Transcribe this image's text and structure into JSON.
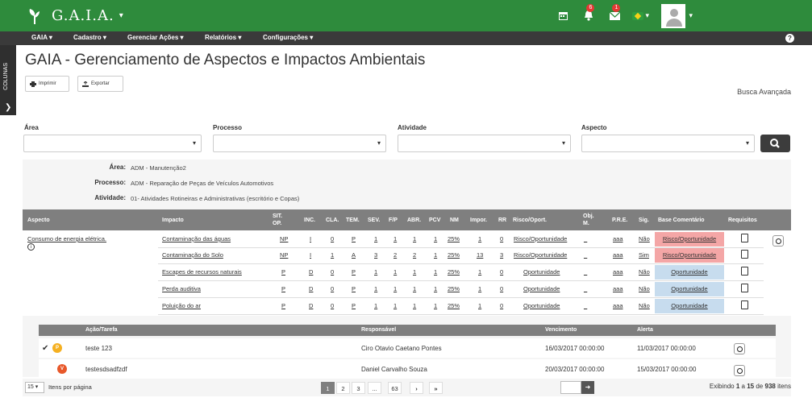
{
  "app": {
    "brand": "G.A.I.A.",
    "brand_caret": "▾"
  },
  "top_icons": {
    "notifications_count": "6",
    "messages_count": "1"
  },
  "menu": [
    {
      "label": "GAIA ▾"
    },
    {
      "label": "Cadastro ▾"
    },
    {
      "label": "Gerenciar Ações ▾"
    },
    {
      "label": "Relatórios ▾"
    },
    {
      "label": "Configurações ▾"
    }
  ],
  "help_label": "?",
  "side_panel": {
    "label": "COLUNAS"
  },
  "page_title": "GAIA - Gerenciamento de Aspectos e Impactos Ambientais",
  "toolbar": {
    "print_label": "Imprimir",
    "export_label": "Exportar"
  },
  "advanced_search": "Busca Avançada",
  "filters": [
    {
      "label": "Área",
      "value": ""
    },
    {
      "label": "Processo",
      "value": ""
    },
    {
      "label": "Atividade",
      "value": ""
    },
    {
      "label": "Aspecto",
      "value": ""
    }
  ],
  "info": {
    "area_label": "Área:",
    "area_value": "ADM - Manutenção2",
    "processo_label": "Processo:",
    "processo_value": "ADM - Reparação de Peças de Veículos Automotivos",
    "atividade_label": "Atividade:",
    "atividade_value": "01- Atividades Rotineiras e Administrativas (escritório e Copas)"
  },
  "table": {
    "headers": [
      "Aspecto",
      "Impacto",
      "SIT. OP.",
      "INC.",
      "CLA.",
      "TEM.",
      "SEV.",
      "F/P",
      "ABR.",
      "PCV",
      "NM",
      "Impor.",
      "RR",
      "Risco/Oport.",
      "Obj. M.",
      "P.R.E.",
      "Sig.",
      "Base Comentário",
      "Requisitos"
    ],
    "aspecto": "Consumo de energia elétrica.",
    "rows": [
      {
        "impacto": "Contaminação das águas",
        "sit": "NP",
        "inc": "I",
        "cla": "0",
        "tem": "P",
        "sev": "1",
        "fp": "1",
        "abr": "1",
        "pcv": "1",
        "nm": "25%",
        "impor": "1",
        "rr": "0",
        "risco": "Risco/Oportunidade",
        "obj": "_",
        "pre": "aaa",
        "sig": "Não",
        "base": "Risco/Oportunidade",
        "base_color": "#f4a6a6"
      },
      {
        "impacto": "Contaminação do Solo",
        "sit": "NP",
        "inc": "I",
        "cla": "1",
        "tem": "A",
        "sev": "3",
        "fp": "2",
        "abr": "2",
        "pcv": "1",
        "nm": "25%",
        "impor": "13",
        "rr": "3",
        "risco": "Risco/Oportunidade",
        "obj": "_",
        "pre": "aaa",
        "sig": "Sim",
        "base": "Risco/Oportunidade",
        "base_color": "#f4a6a6"
      },
      {
        "impacto": "Escapes de recursos naturais",
        "sit": "P",
        "inc": "D",
        "cla": "0",
        "tem": "P",
        "sev": "1",
        "fp": "1",
        "abr": "1",
        "pcv": "1",
        "nm": "25%",
        "impor": "1",
        "rr": "0",
        "risco": "Oportunidade",
        "obj": "_",
        "pre": "aaa",
        "sig": "Não",
        "base": "Oportunidade",
        "base_color": "#c7dcee"
      },
      {
        "impacto": "Perda auditiva",
        "sit": "P",
        "inc": "D",
        "cla": "0",
        "tem": "P",
        "sev": "1",
        "fp": "1",
        "abr": "1",
        "pcv": "1",
        "nm": "25%",
        "impor": "1",
        "rr": "0",
        "risco": "Oportunidade",
        "obj": "_",
        "pre": "aaa",
        "sig": "Não",
        "base": "Oportunidade",
        "base_color": "#c7dcee"
      },
      {
        "impacto": "Poluição do ar",
        "sit": "P",
        "inc": "D",
        "cla": "0",
        "tem": "P",
        "sev": "1",
        "fp": "1",
        "abr": "1",
        "pcv": "1",
        "nm": "25%",
        "impor": "1",
        "rr": "0",
        "risco": "Oportunidade",
        "obj": "_",
        "pre": "aaa",
        "sig": "Não",
        "base": "Oportunidade",
        "base_color": "#c7dcee"
      }
    ]
  },
  "acoes": {
    "headers": [
      "Ação/Tarefa",
      "Responsável",
      "Vencimento",
      "Alerta"
    ],
    "rows": [
      {
        "check": "✔",
        "status": "P",
        "status_color": "#f5b021",
        "tarefa": "teste 123",
        "responsavel": "Ciro Otavio Caetano Pontes",
        "vencimento": "16/03/2017 00:00:00",
        "alerta": "11/03/2017 00:00:00"
      },
      {
        "check": "",
        "status": "V",
        "status_color": "#e8582a",
        "tarefa": "testesdsadfzdf",
        "responsavel": "Daniel Carvalho Souza",
        "vencimento": "20/03/2017 00:00:00",
        "alerta": "15/03/2017 00:00:00"
      }
    ]
  },
  "pagination": {
    "per_page": "15 ▾",
    "per_page_label": "Itens por página",
    "pages": [
      "1",
      "2",
      "3",
      "...",
      "63",
      "›",
      "»"
    ],
    "goto_label": "➜",
    "exibindo_prefix": "Exibindo",
    "exibindo_from": "1",
    "exibindo_sep": "a",
    "exibindo_to": "15",
    "exibindo_de": "de",
    "exibindo_total": "938",
    "exibindo_suffix": "itens"
  }
}
